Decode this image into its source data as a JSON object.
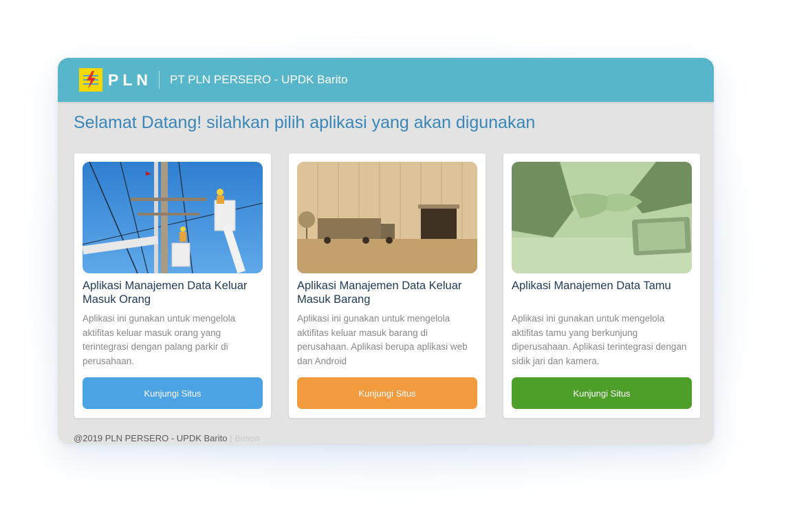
{
  "header": {
    "logo_text": "PLN",
    "org_title": "PT PLN PERSERO - UPDK Barito"
  },
  "welcome": "Selamat Datang! silahkan pilih aplikasi yang akan digunakan",
  "cards": [
    {
      "title": "Aplikasi Manajemen Data Keluar Masuk Orang",
      "description": "Aplikasi ini gunakan untuk mengelola aktifitas keluar masuk orang yang terintegrasi dengan palang parkir di perusahaan.",
      "button_label": "Kunjungi Situs",
      "button_color": "#4ba3e3",
      "image": "linemen-on-power-pole"
    },
    {
      "title": "Aplikasi Manajemen Data Keluar Masuk Barang",
      "description": "Aplikasi ini gunakan untuk mengelola aktifitas keluar masuk barang di perusahaan. Aplikasi berupa aplikasi web dan Android",
      "button_label": "Kunjungi Situs",
      "button_color": "#f19a3e",
      "image": "truck-at-warehouse"
    },
    {
      "title": "Aplikasi Manajemen Data Tamu",
      "description": "Aplikasi ini gunakan untuk mengelola aktifitas tamu yang berkunjung diperusahaan. Aplikasi terintegrasi dengan sidik jari dan kamera.",
      "button_label": "Kunjungi Situs",
      "button_color": "#4e9f2a",
      "image": "business-handshake"
    }
  ],
  "footer": {
    "copyright": "@2019 PLN PERSERO - UPDK Barito",
    "credit": "| Bimon"
  },
  "colors": {
    "header_bg": "#57b6c9",
    "welcome_text": "#3a86b8",
    "page_bg": "#e3e3e3"
  }
}
